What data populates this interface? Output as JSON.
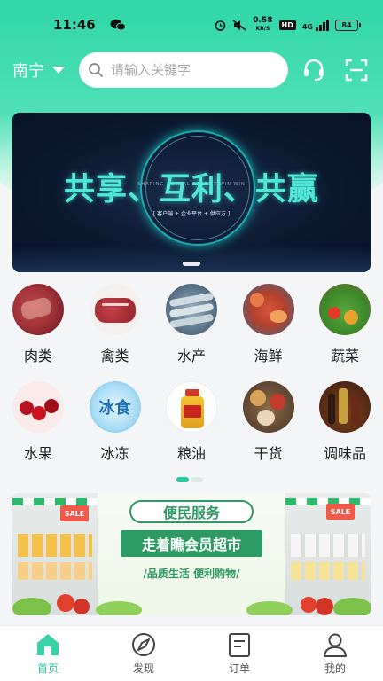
{
  "status_bar": {
    "time": "11:46",
    "net_speed_value": "0.58",
    "net_speed_unit": "KB/S",
    "hd": "HD",
    "signal": "4G",
    "battery": "84"
  },
  "header": {
    "city": "南宁",
    "search_placeholder": "请输入关键字"
  },
  "banner": {
    "title": "共享、互利、共赢",
    "tagline": "SHARING·MUTUAL BENEFIT·WIN-WIN",
    "subtitle": "[ 客户端 + 企业平台 + 供应方 ]"
  },
  "categories": [
    {
      "label": "肉类",
      "icon": "meat-icon"
    },
    {
      "label": "禽类",
      "icon": "poultry-icon"
    },
    {
      "label": "水产",
      "icon": "fish-icon"
    },
    {
      "label": "海鲜",
      "icon": "seafood-icon"
    },
    {
      "label": "蔬菜",
      "icon": "vegetables-icon"
    },
    {
      "label": "水果",
      "icon": "cherries-icon"
    },
    {
      "label": "冰冻",
      "icon": "frozen-icon"
    },
    {
      "label": "粮油",
      "icon": "oil-bottle-icon"
    },
    {
      "label": "干货",
      "icon": "dried-goods-icon"
    },
    {
      "label": "调味品",
      "icon": "seasoning-icon"
    }
  ],
  "frozen_icon_text": "冰食",
  "promo": {
    "heading": "便民服务",
    "main": "走着瞧会员超市",
    "slogan": "/品质生活  便利购物/",
    "sale": "SALE"
  },
  "nav": [
    {
      "label": "首页",
      "icon": "home-icon",
      "active": true
    },
    {
      "label": "发现",
      "icon": "discover-icon",
      "active": false
    },
    {
      "label": "订单",
      "icon": "order-icon",
      "active": false
    },
    {
      "label": "我的",
      "icon": "profile-icon",
      "active": false
    }
  ],
  "colors": {
    "accent": "#2fc4a0",
    "header_gradient_top": "#2fd6a8",
    "promo_green": "#2e9a63"
  }
}
